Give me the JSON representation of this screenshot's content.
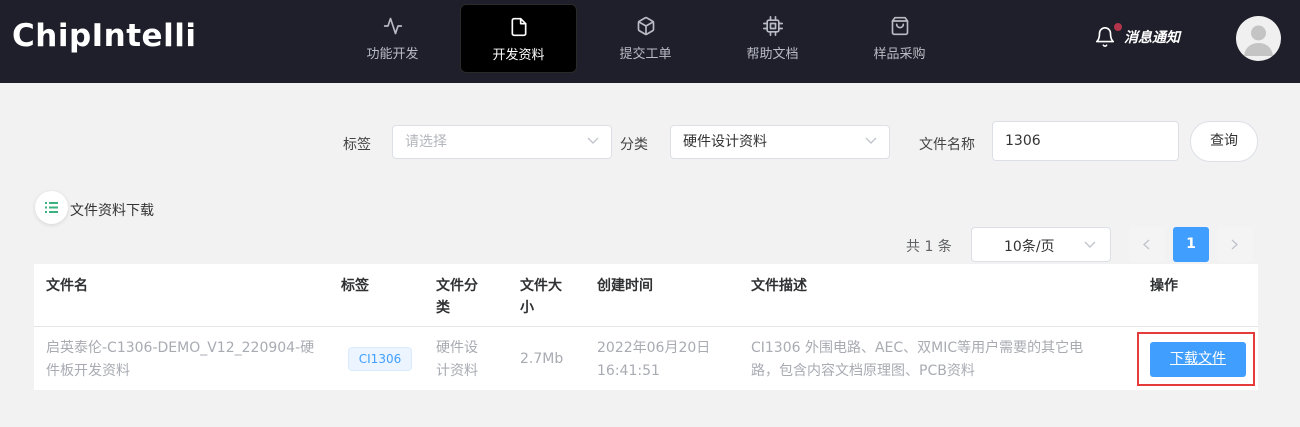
{
  "header": {
    "logo": "ChipIntelli",
    "nav": [
      {
        "label": "功能开发",
        "icon": "activity-icon"
      },
      {
        "label": "开发资料",
        "icon": "file-icon",
        "active": true
      },
      {
        "label": "提交工单",
        "icon": "cube-icon"
      },
      {
        "label": "帮助文档",
        "icon": "chip-icon"
      },
      {
        "label": "样品采购",
        "icon": "shopping-bag-icon"
      }
    ],
    "notice_label": "消息通知",
    "colors": {
      "bg": "#1f1f2b",
      "active_bg": "#000000",
      "badge": "#b1354b"
    }
  },
  "filter": {
    "tag_label": "标签",
    "tag_placeholder": "请选择",
    "category_label": "分类",
    "category_value": "硬件设计资料",
    "filename_label": "文件名称",
    "filename_value": "1306",
    "query_label": "查询"
  },
  "section": {
    "title": "文件资料下载",
    "icon": "list-icon"
  },
  "pagination": {
    "total_text": "共 1 条",
    "page_size": "10条/页",
    "current_page": "1"
  },
  "table": {
    "headers": {
      "name": "文件名",
      "tag": "标签",
      "category_l1": "文件分",
      "category_l2": "类",
      "size_l1": "文件大",
      "size_l2": "小",
      "created": "创建时间",
      "desc": "文件描述",
      "action": "操作"
    },
    "rows": [
      {
        "name_l1": "启英泰伦-C1306-DEMO_V12_220904-硬",
        "name_l2": "件板开发资料",
        "tag": "CI1306",
        "category_l1": "硬件设",
        "category_l2": "计资料",
        "size": "2.7Mb",
        "created_l1": "2022年06月20日",
        "created_l2": "16:41:51",
        "desc_l1": "CI1306 外围电路、AEC、双MIC等用户需要的其它电",
        "desc_l2": "路，包含内容文档原理图、PCB资料",
        "action": "下载文件"
      }
    ]
  },
  "accent_color": "#409eff",
  "highlight_color": "#e53b3b"
}
